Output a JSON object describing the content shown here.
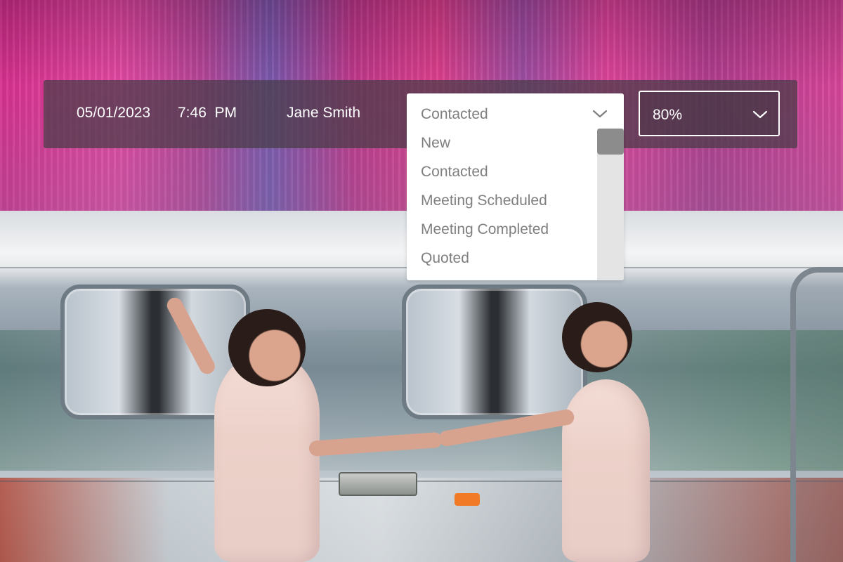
{
  "toolbar": {
    "date": "05/01/2023",
    "time": "7:46  PM",
    "contact_name": "Jane Smith"
  },
  "status_dropdown": {
    "selected": "Contacted",
    "options": [
      "New",
      "Contacted",
      "Meeting Scheduled",
      "Meeting Completed",
      "Quoted"
    ],
    "chevron_icon": "chevron-down-icon"
  },
  "probability_dropdown": {
    "selected": "80%",
    "chevron_icon": "chevron-down-icon"
  },
  "colors": {
    "toolbar_bg": "#463c46",
    "dropdown_text": "#7f7f7f",
    "scroll_thumb": "#8c8c8c",
    "scroll_track": "#e4e4e4"
  }
}
